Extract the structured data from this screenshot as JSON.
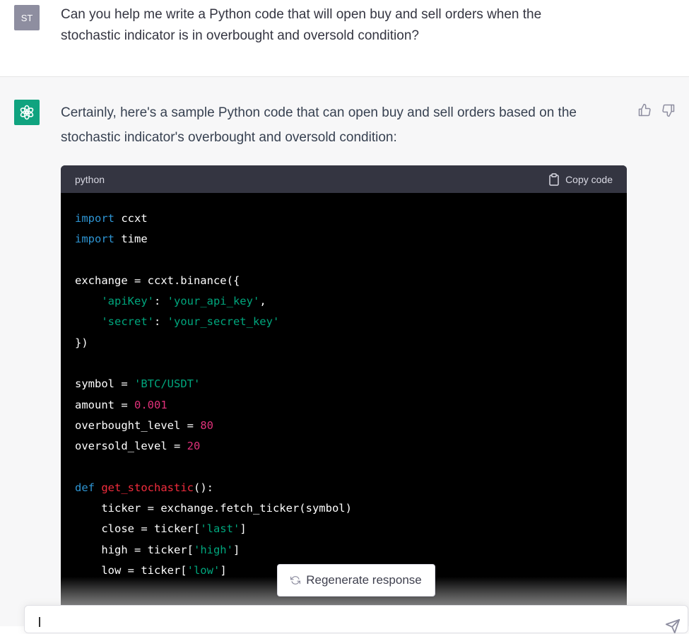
{
  "user": {
    "avatar_initials": "ST",
    "message": "Can you help me write a Python code that will open buy and sell orders when the stochastic indicator is in overbought and oversold condition?"
  },
  "assistant": {
    "avatar_icon": "openai-logo-icon",
    "intro": "Certainly, here's a sample Python code that can open buy and sell orders based on the stochastic indicator's overbought and oversold condition:",
    "feedback_icons": [
      "thumbs-up-icon",
      "thumbs-down-icon"
    ]
  },
  "code_block": {
    "language": "python",
    "copy_label": "Copy code",
    "lines": [
      [
        {
          "t": "kw",
          "v": "import"
        },
        {
          "t": "",
          "v": " ccxt"
        }
      ],
      [
        {
          "t": "kw",
          "v": "import"
        },
        {
          "t": "",
          "v": " time"
        }
      ],
      [],
      [
        {
          "t": "",
          "v": "exchange = ccxt.binance({"
        }
      ],
      [
        {
          "t": "",
          "v": "    "
        },
        {
          "t": "str",
          "v": "'apiKey'"
        },
        {
          "t": "",
          "v": ": "
        },
        {
          "t": "str",
          "v": "'your_api_key'"
        },
        {
          "t": "",
          "v": ","
        }
      ],
      [
        {
          "t": "",
          "v": "    "
        },
        {
          "t": "str",
          "v": "'secret'"
        },
        {
          "t": "",
          "v": ": "
        },
        {
          "t": "str",
          "v": "'your_secret_key'"
        }
      ],
      [
        {
          "t": "",
          "v": "})"
        }
      ],
      [],
      [
        {
          "t": "",
          "v": "symbol = "
        },
        {
          "t": "str",
          "v": "'BTC/USDT'"
        }
      ],
      [
        {
          "t": "",
          "v": "amount = "
        },
        {
          "t": "num",
          "v": "0.001"
        }
      ],
      [
        {
          "t": "",
          "v": "overbought_level = "
        },
        {
          "t": "num",
          "v": "80"
        }
      ],
      [
        {
          "t": "",
          "v": "oversold_level = "
        },
        {
          "t": "num",
          "v": "20"
        }
      ],
      [],
      [
        {
          "t": "kw",
          "v": "def"
        },
        {
          "t": "",
          "v": " "
        },
        {
          "t": "fn",
          "v": "get_stochastic"
        },
        {
          "t": "",
          "v": "():"
        }
      ],
      [
        {
          "t": "",
          "v": "    ticker = exchange.fetch_ticker(symbol)"
        }
      ],
      [
        {
          "t": "",
          "v": "    close = ticker["
        },
        {
          "t": "str",
          "v": "'last'"
        },
        {
          "t": "",
          "v": "]"
        }
      ],
      [
        {
          "t": "",
          "v": "    high = ticker["
        },
        {
          "t": "str",
          "v": "'high'"
        },
        {
          "t": "",
          "v": "]"
        }
      ],
      [
        {
          "t": "",
          "v": "    low = ticker["
        },
        {
          "t": "str",
          "v": "'low'"
        },
        {
          "t": "",
          "v": "]"
        }
      ]
    ]
  },
  "regenerate": {
    "label": "Regenerate response",
    "icon": "refresh-icon"
  },
  "composer": {
    "value": "",
    "send_icon": "send-icon"
  },
  "colors": {
    "user_avatar": "#8e8ea0",
    "bot_avatar": "#10a37f",
    "code_header": "#343541",
    "code_bg": "#000000",
    "keyword": "#2e95d3",
    "string": "#00a67d",
    "number": "#df3079",
    "function": "#f22c3d"
  }
}
